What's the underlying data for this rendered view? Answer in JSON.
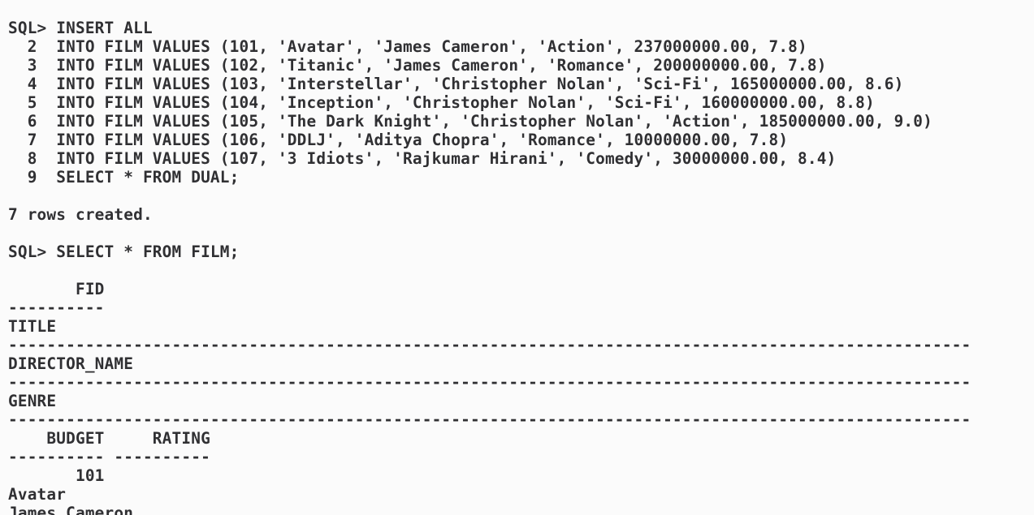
{
  "terminal": {
    "lines": [
      "SQL> INSERT ALL",
      "  2  INTO FILM VALUES (101, 'Avatar', 'James Cameron', 'Action', 237000000.00, 7.8)",
      "  3  INTO FILM VALUES (102, 'Titanic', 'James Cameron', 'Romance', 200000000.00, 7.8)",
      "  4  INTO FILM VALUES (103, 'Interstellar', 'Christopher Nolan', 'Sci-Fi', 165000000.00, 8.6)",
      "  5  INTO FILM VALUES (104, 'Inception', 'Christopher Nolan', 'Sci-Fi', 160000000.00, 8.8)",
      "  6  INTO FILM VALUES (105, 'The Dark Knight', 'Christopher Nolan', 'Action', 185000000.00, 9.0)",
      "  7  INTO FILM VALUES (106, 'DDLJ', 'Aditya Chopra', 'Romance', 10000000.00, 7.8)",
      "  8  INTO FILM VALUES (107, '3 Idiots', 'Rajkumar Hirani', 'Comedy', 30000000.00, 8.4)",
      "  9  SELECT * FROM DUAL;",
      "",
      "7 rows created.",
      "",
      "SQL> SELECT * FROM FILM;",
      "",
      "       FID",
      "----------",
      "TITLE",
      "----------------------------------------------------------------------------------------------------",
      "DIRECTOR_NAME",
      "----------------------------------------------------------------------------------------------------",
      "GENRE",
      "----------------------------------------------------------------------------------------------------",
      "    BUDGET     RATING",
      "---------- ----------",
      "       101",
      "Avatar",
      "James Cameron"
    ]
  }
}
